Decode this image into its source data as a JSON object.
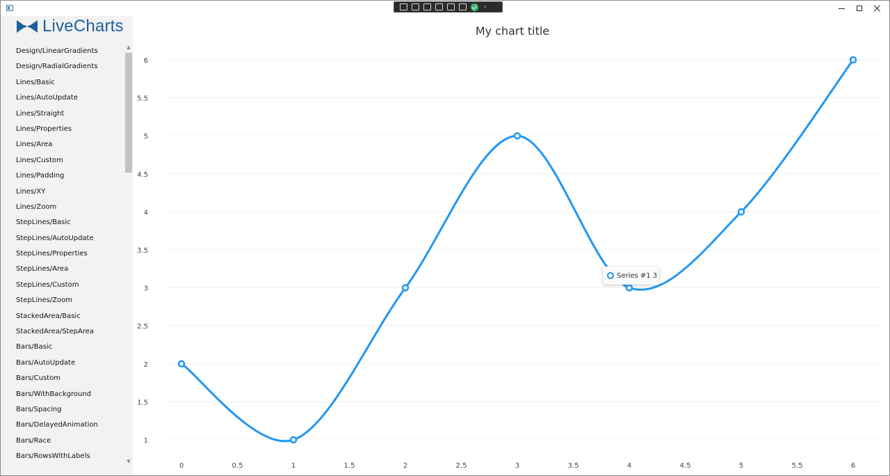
{
  "app": {
    "logo_text": "LiveCharts"
  },
  "sidebar": {
    "items": [
      "Design/LinearGradients",
      "Design/RadialGradients",
      "Lines/Basic",
      "Lines/AutoUpdate",
      "Lines/Straight",
      "Lines/Properties",
      "Lines/Area",
      "Lines/Custom",
      "Lines/Padding",
      "Lines/XY",
      "Lines/Zoom",
      "StepLines/Basic",
      "StepLines/AutoUpdate",
      "StepLines/Properties",
      "StepLines/Area",
      "StepLines/Custom",
      "StepLines/Zoom",
      "StackedArea/Basic",
      "StackedArea/StepArea",
      "Bars/Basic",
      "Bars/AutoUpdate",
      "Bars/Custom",
      "Bars/WithBackground",
      "Bars/Spacing",
      "Bars/DelayedAnimation",
      "Bars/Race",
      "Bars/RowsWithLabels"
    ]
  },
  "tooltip": {
    "text": "Series #1 3"
  },
  "colors": {
    "series": "#2196f3",
    "logo": "#1e5f9a"
  },
  "chart_data": {
    "type": "line",
    "title": "My chart title",
    "xlabel": "",
    "ylabel": "",
    "x": [
      0,
      1,
      2,
      3,
      4,
      5,
      6
    ],
    "series": [
      {
        "values": [
          2,
          1,
          3,
          5,
          3,
          4,
          6
        ]
      }
    ],
    "xlim": [
      0,
      6
    ],
    "ylim": [
      1,
      6
    ],
    "x_ticks": [
      "0",
      "0.5",
      "1",
      "1.5",
      "2",
      "2.5",
      "3",
      "3.5",
      "4",
      "4.5",
      "5",
      "5.5",
      "6"
    ],
    "y_ticks": [
      "1",
      "1.5",
      "2",
      "2.5",
      "3",
      "3.5",
      "4",
      "4.5",
      "5",
      "5.5",
      "6"
    ],
    "grid": true,
    "smooth": true
  }
}
